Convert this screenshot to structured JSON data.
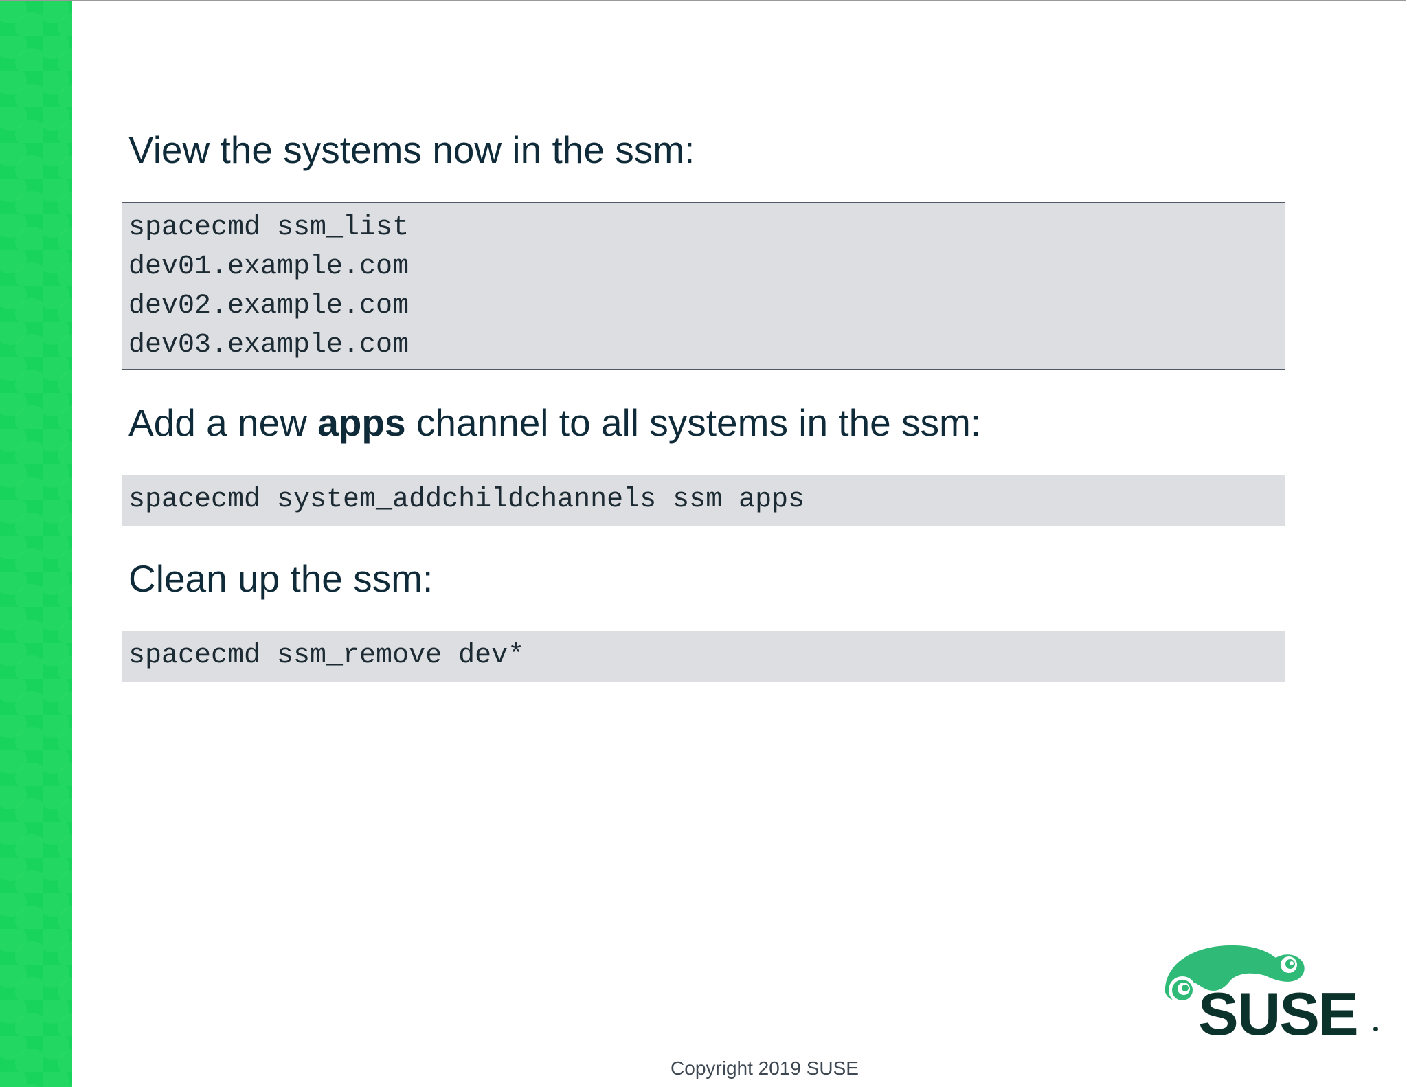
{
  "slide": {
    "headings": [
      {
        "text": "View the systems now in the ssm:"
      },
      {
        "before": "Add a new ",
        "bold": "apps",
        "after": " channel to all systems in the ssm:"
      },
      {
        "text": "Clean up the ssm:"
      }
    ],
    "code_blocks": [
      {
        "lines": [
          "spacecmd ssm_list",
          "dev01.example.com",
          "dev02.example.com",
          "dev03.example.com"
        ]
      },
      {
        "lines": [
          "spacecmd system_addchildchannels ssm apps"
        ]
      },
      {
        "lines": [
          "spacecmd ssm_remove dev*"
        ]
      }
    ]
  },
  "footer": {
    "copyright": "Copyright 2019 SUSE"
  },
  "logo": {
    "icon": "suse-chameleon-logo",
    "wordmark": "SUSE",
    "wordmark_color": "#0c322c",
    "chameleon_color": "#30ba78"
  },
  "theme": {
    "side_band_color": "#19d45c",
    "code_background": "#dcdee1",
    "heading_color": "#0f2a38"
  }
}
